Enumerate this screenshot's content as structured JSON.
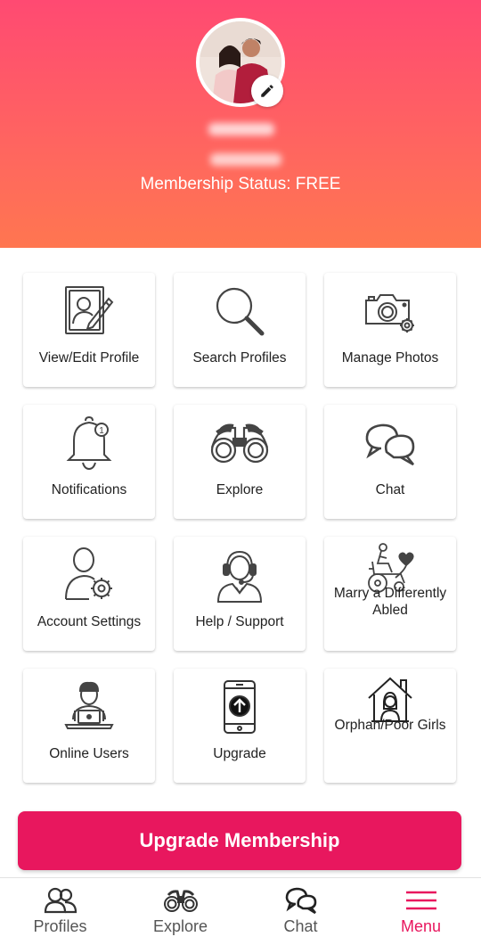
{
  "header": {
    "membership_label": "Membership Status: ",
    "membership_value": "FREE"
  },
  "tiles": [
    {
      "label": "View/Edit Profile",
      "icon": "profile-edit-icon"
    },
    {
      "label": "Search Profiles",
      "icon": "search-icon"
    },
    {
      "label": "Manage Photos",
      "icon": "camera-gear-icon"
    },
    {
      "label": "Notifications",
      "icon": "bell-icon",
      "badge": "1"
    },
    {
      "label": "Explore",
      "icon": "binoculars-icon"
    },
    {
      "label": "Chat",
      "icon": "chat-bubbles-icon"
    },
    {
      "label": "Account Settings",
      "icon": "user-gear-icon"
    },
    {
      "label": "Help / Support",
      "icon": "headset-agent-icon"
    },
    {
      "label": "Marry a Differently Abled",
      "icon": "wheelchair-heart-icon"
    },
    {
      "label": "Online Users",
      "icon": "user-laptop-icon"
    },
    {
      "label": "Upgrade",
      "icon": "phone-upgrade-icon"
    },
    {
      "label": "Orphan/Poor Girls",
      "icon": "house-girl-icon"
    }
  ],
  "upgrade_button": "Upgrade Membership",
  "bottom_nav": [
    {
      "label": "Profiles",
      "icon": "profiles-icon"
    },
    {
      "label": "Explore",
      "icon": "binoculars-icon"
    },
    {
      "label": "Chat",
      "icon": "chat-icon"
    },
    {
      "label": "Menu",
      "icon": "menu-icon",
      "active": true
    }
  ],
  "colors": {
    "accent": "#e8175e",
    "header_top": "#ff4a72",
    "header_bottom": "#ff7650"
  }
}
